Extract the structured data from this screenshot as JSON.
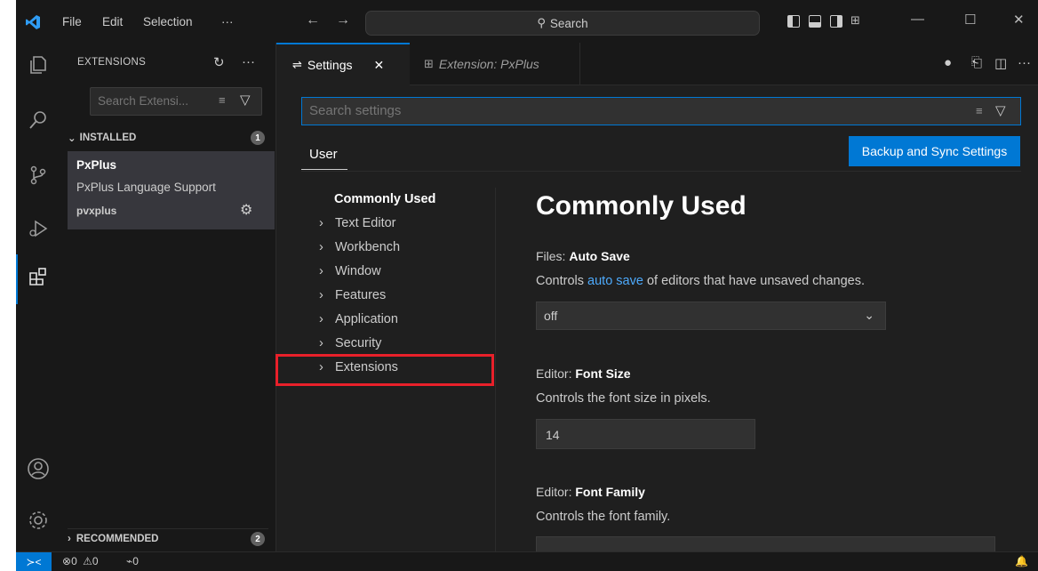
{
  "menu": {
    "file": "File",
    "edit": "Edit",
    "selection": "Selection",
    "more": "···"
  },
  "titlebar": {
    "search_label": "Search"
  },
  "sidebar": {
    "title": "EXTENSIONS",
    "search_placeholder": "Search Extensi...",
    "installed": {
      "label": "INSTALLED",
      "count": "1"
    },
    "extension": {
      "name": "PxPlus",
      "description": "PxPlus Language Support",
      "publisher": "pvxplus"
    },
    "recommended": {
      "label": "RECOMMENDED",
      "count": "2"
    }
  },
  "tabs": [
    {
      "label": "Settings",
      "close": "✕"
    },
    {
      "label": "Extension: PxPlus"
    }
  ],
  "settings": {
    "search_placeholder": "Search settings",
    "scope_tab": "User",
    "sync_button": "Backup and Sync Settings",
    "toc": {
      "title": "Commonly Used",
      "items": [
        "Text Editor",
        "Workbench",
        "Window",
        "Features",
        "Application",
        "Security",
        "Extensions"
      ]
    },
    "heading": "Commonly Used",
    "items": [
      {
        "category": "Files: ",
        "name": "Auto Save",
        "desc_prefix": "Controls ",
        "desc_link": "auto save",
        "desc_suffix": " of editors that have unsaved changes.",
        "value": "off"
      },
      {
        "category": "Editor: ",
        "name": "Font Size",
        "desc": "Controls the font size in pixels.",
        "value": "14"
      },
      {
        "category": "Editor: ",
        "name": "Font Family",
        "desc": "Controls the font family."
      }
    ]
  },
  "statusbar": {
    "errors": "0",
    "warnings": "0",
    "ports": "0"
  },
  "colors": {
    "accent": "#0078d4",
    "highlight_box": "#e8202a"
  }
}
